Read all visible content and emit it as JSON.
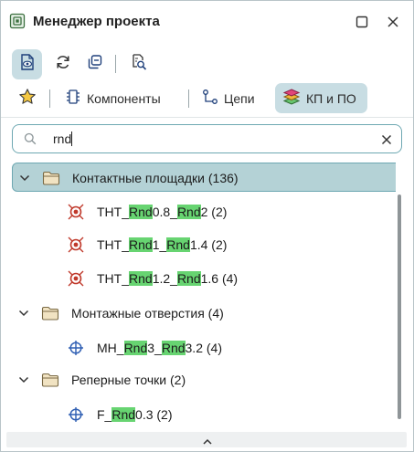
{
  "window": {
    "title": "Менеджер проекта",
    "icons": {
      "app": "project-manager-icon",
      "maximize": "maximize-icon",
      "close": "close-icon"
    }
  },
  "toolbar": {
    "buttons": [
      {
        "icon": "document-view-icon",
        "active": true
      },
      {
        "icon": "refresh-icon",
        "active": false
      },
      {
        "icon": "collapse-all-icon",
        "active": false
      },
      {
        "icon": "inspect-document-icon",
        "active": false
      }
    ]
  },
  "tabs": {
    "favorites_icon": "star-icon",
    "items": [
      {
        "label": "Компоненты",
        "icon": "component-icon",
        "active": false
      },
      {
        "label": "Цепи",
        "icon": "net-icon",
        "active": false
      },
      {
        "label": "КП и ПО",
        "icon": "layers-icon",
        "active": true
      }
    ]
  },
  "search": {
    "value": "rnd",
    "icons": {
      "search": "search-icon",
      "clear": "clear-icon"
    }
  },
  "tree": {
    "groups": [
      {
        "label": "Контактные площадки (136)",
        "expanded": true,
        "selected": true,
        "items": [
          {
            "parts": [
              "THT_",
              "Rnd",
              "0.8_",
              "Rnd",
              "2 (2)"
            ],
            "icon": "pad-icon"
          },
          {
            "parts": [
              "THT_",
              "Rnd",
              "1_",
              "Rnd",
              "1.4 (2)"
            ],
            "icon": "pad-icon"
          },
          {
            "parts": [
              "THT_",
              "Rnd",
              "1.2_",
              "Rnd",
              "1.6 (4)"
            ],
            "icon": "pad-icon"
          }
        ]
      },
      {
        "label": "Монтажные отверстия (4)",
        "expanded": true,
        "selected": false,
        "items": [
          {
            "parts": [
              "MH_",
              "Rnd",
              "3_",
              "Rnd",
              "3.2 (4)"
            ],
            "icon": "crosshair-icon"
          }
        ]
      },
      {
        "label": "Реперные точки (2)",
        "expanded": true,
        "selected": false,
        "items": [
          {
            "parts": [
              "F_",
              "Rnd",
              "0.3 (2)"
            ],
            "icon": "crosshair-icon"
          }
        ]
      }
    ]
  },
  "colors": {
    "accent": "#6ea8b2",
    "active_bg": "#c8dde3",
    "selected_row": "#b4d2d6",
    "highlight": "#67d471",
    "pad_red": "#c0392b",
    "crosshair_blue": "#2f5fb3",
    "folder": "#f1e3c2"
  }
}
